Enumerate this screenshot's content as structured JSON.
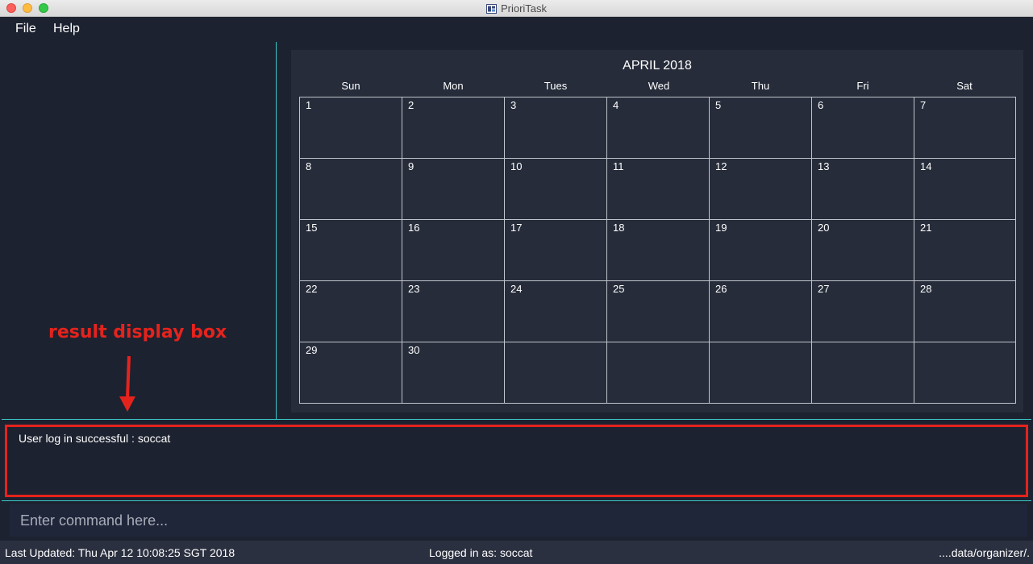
{
  "window": {
    "title": "PrioriTask",
    "app_icon": "prioritask-app-icon"
  },
  "menu": {
    "items": [
      "File",
      "Help"
    ]
  },
  "calendar": {
    "title": "APRIL 2018",
    "day_headers": [
      "Sun",
      "Mon",
      "Tues",
      "Wed",
      "Thu",
      "Fri",
      "Sat"
    ],
    "weeks": [
      [
        "1",
        "2",
        "3",
        "4",
        "5",
        "6",
        "7"
      ],
      [
        "8",
        "9",
        "10",
        "11",
        "12",
        "13",
        "14"
      ],
      [
        "15",
        "16",
        "17",
        "18",
        "19",
        "20",
        "21"
      ],
      [
        "22",
        "23",
        "24",
        "25",
        "26",
        "27",
        "28"
      ],
      [
        "29",
        "30",
        "",
        "",
        "",
        "",
        ""
      ]
    ]
  },
  "result_display": {
    "text": "User log in successful : soccat"
  },
  "command": {
    "placeholder": "Enter command here...",
    "value": ""
  },
  "status_bar": {
    "last_updated": "Last Updated: Thu Apr 12 10:08:25 SGT 2018",
    "logged_in": "Logged in as: soccat",
    "file_path": "....data/organizer/."
  },
  "annotation": {
    "label": "result display box",
    "color": "#e5231d"
  },
  "colors": {
    "background": "#1d2230",
    "calendar_bg": "#262c3a",
    "accent_divider": "#3cc8c8",
    "status_bar": "#2b3040"
  }
}
